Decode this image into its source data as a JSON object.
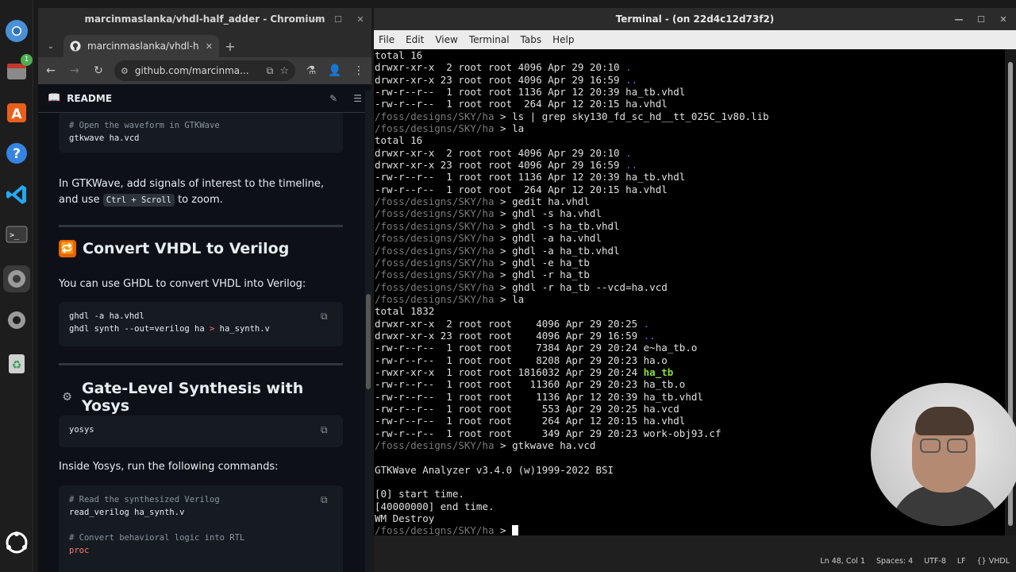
{
  "dock": {
    "badge": "1"
  },
  "chromium": {
    "window_title": "marcinmaslanka/vhdl-half_adder - Chromium",
    "tab_title": "marcinmaslanka/vhdl-ha",
    "url": "github.com/marcinma...",
    "readme_label": "README"
  },
  "readme": {
    "code1_comment": "# Open the waveform in GTKWave",
    "code1_line": "gtkwave ha.vcd",
    "p1_text": "In GTKWave, add signals of interest to the timeline, and use",
    "p1_code": "Ctrl + Scroll",
    "p1_end": "to zoom.",
    "h2_convert": "Convert VHDL to Verilog",
    "p2_text": "You can use GHDL to convert VHDL into Verilog:",
    "code2_line1": "ghdl -a ha.vhdl",
    "code2_line2a": "ghdl synth --out=verilog ha ",
    "code2_op": ">",
    "code2_line2b": " ha_synth.v",
    "h2_synth": "Gate-Level Synthesis with Yosys",
    "code3_line": "yosys",
    "p3_text": "Inside Yosys, run the following commands:",
    "code4_comment1": "# Read the synthesized Verilog",
    "code4_line1": "read_verilog ha_synth.v",
    "code4_comment2": "# Convert behavioral logic into RTL",
    "code4_line2": "proc"
  },
  "terminal": {
    "window_title": "Terminal - (on 22d4c12d73f2)",
    "menu": [
      "File",
      "Edit",
      "View",
      "Terminal",
      "Tabs",
      "Help"
    ],
    "prompt_path": "/foss/designs/SKY/ha",
    "lines": [
      {
        "t": "out",
        "text": "total 16"
      },
      {
        "t": "out",
        "text": "drwxr-xr-x  2 root root 4096 Apr 29 20:10 ",
        "dir": "."
      },
      {
        "t": "out",
        "text": "drwxr-xr-x 23 root root 4096 Apr 29 16:59 ",
        "dir": ".."
      },
      {
        "t": "out",
        "text": "-rw-r--r--  1 root root 1136 Apr 12 20:39 ha_tb.vhdl"
      },
      {
        "t": "out",
        "text": "-rw-r--r--  1 root root  264 Apr 12 20:15 ha.vhdl"
      },
      {
        "t": "cmd",
        "text": "ls | grep sky130_fd_sc_hd__tt_025C_1v80.lib"
      },
      {
        "t": "cmd",
        "text": "la"
      },
      {
        "t": "out",
        "text": "total 16"
      },
      {
        "t": "out",
        "text": "drwxr-xr-x  2 root root 4096 Apr 29 20:10 ",
        "dir": "."
      },
      {
        "t": "out",
        "text": "drwxr-xr-x 23 root root 4096 Apr 29 16:59 ",
        "dir": ".."
      },
      {
        "t": "out",
        "text": "-rw-r--r--  1 root root 1136 Apr 12 20:39 ha_tb.vhdl"
      },
      {
        "t": "out",
        "text": "-rw-r--r--  1 root root  264 Apr 12 20:15 ha.vhdl"
      },
      {
        "t": "cmd",
        "text": "gedit ha.vhdl"
      },
      {
        "t": "cmd",
        "text": "ghdl -s ha.vhdl"
      },
      {
        "t": "cmd",
        "text": "ghdl -s ha_tb.vhdl"
      },
      {
        "t": "cmd",
        "text": "ghdl -a ha.vhdl"
      },
      {
        "t": "cmd",
        "text": "ghdl -a ha_tb.vhdl"
      },
      {
        "t": "cmd",
        "text": "ghdl -e ha_tb"
      },
      {
        "t": "cmd",
        "text": "ghdl -r ha_tb"
      },
      {
        "t": "cmd",
        "text": "ghdl -r ha_tb --vcd=ha.vcd"
      },
      {
        "t": "cmd",
        "text": "la"
      },
      {
        "t": "out",
        "text": "total 1832"
      },
      {
        "t": "out",
        "text": "drwxr-xr-x  2 root root    4096 Apr 29 20:25 ",
        "dir": "."
      },
      {
        "t": "out",
        "text": "drwxr-xr-x 23 root root    4096 Apr 29 16:59 ",
        "dir": ".."
      },
      {
        "t": "out",
        "text": "-rw-r--r--  1 root root    7384 Apr 29 20:24 e~ha_tb.o"
      },
      {
        "t": "out",
        "text": "-rw-r--r--  1 root root    8208 Apr 29 20:23 ha.o"
      },
      {
        "t": "out",
        "text": "-rwxr-xr-x  1 root root 1816032 Apr 29 20:24 ",
        "exe": "ha_tb"
      },
      {
        "t": "out",
        "text": "-rw-r--r--  1 root root   11360 Apr 29 20:23 ha_tb.o"
      },
      {
        "t": "out",
        "text": "-rw-r--r--  1 root root    1136 Apr 12 20:39 ha_tb.vhdl"
      },
      {
        "t": "out",
        "text": "-rw-r--r--  1 root root     553 Apr 29 20:25 ha.vcd"
      },
      {
        "t": "out",
        "text": "-rw-r--r--  1 root root     264 Apr 12 20:15 ha.vhdl"
      },
      {
        "t": "out",
        "text": "-rw-r--r--  1 root root     349 Apr 29 20:23 work-obj93.cf"
      },
      {
        "t": "cmd",
        "text": "gtkwave ha.vcd"
      },
      {
        "t": "out",
        "text": ""
      },
      {
        "t": "out",
        "text": "GTKWave Analyzer v3.4.0 (w)1999-2022 BSI"
      },
      {
        "t": "out",
        "text": ""
      },
      {
        "t": "out",
        "text": "[0] start time."
      },
      {
        "t": "out",
        "text": "[40000000] end time."
      },
      {
        "t": "out",
        "text": "WM Destroy"
      },
      {
        "t": "cur",
        "text": ""
      }
    ],
    "status_items": [
      "Ln 48, Col 1",
      "Spaces: 4",
      "UTF-8",
      "LF",
      "{} VHDL"
    ]
  }
}
